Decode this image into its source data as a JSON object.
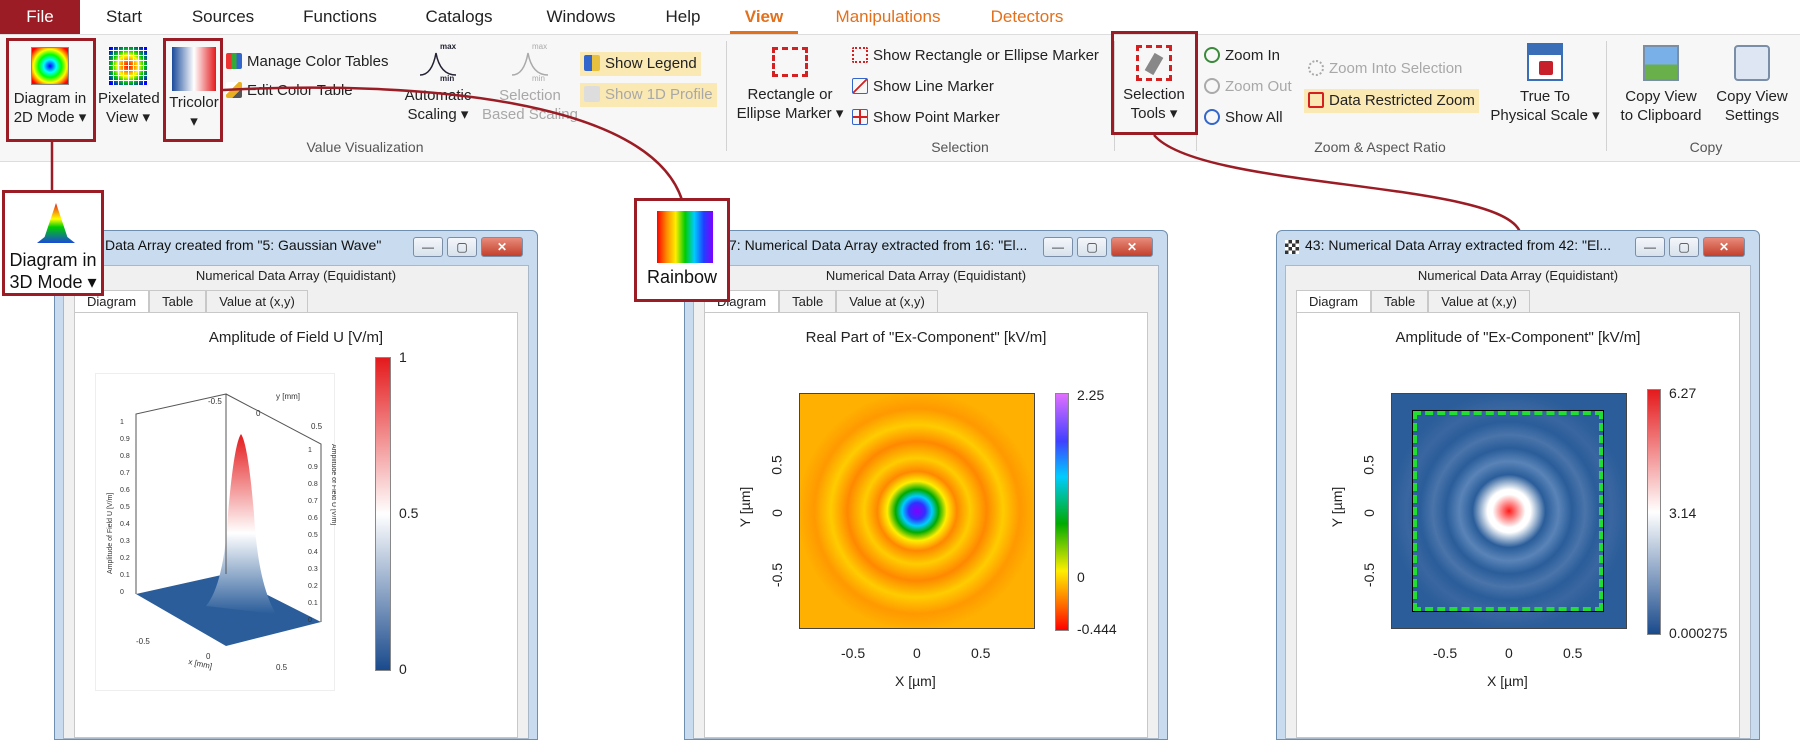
{
  "tabs": [
    "File",
    "Start",
    "Sources",
    "Functions",
    "Catalogs",
    "Windows",
    "Help",
    "View",
    "Manipulations",
    "Detectors"
  ],
  "ribbon": {
    "diagram2d": [
      "Diagram in",
      "2D Mode"
    ],
    "pixelated": [
      "Pixelated",
      "View"
    ],
    "tricolor": [
      "Tricolor"
    ],
    "manage_color_tables": "Manage Color Tables",
    "edit_color_table": "Edit Color Table",
    "auto_scaling": [
      "Automatic",
      "Scaling"
    ],
    "auto_scaling_icon": {
      "max": "max",
      "min": "min"
    },
    "selection_based": [
      "Selection",
      "Based Scaling"
    ],
    "show_legend": "Show Legend",
    "show_1d_profile": "Show 1D Profile",
    "rect_ellipse_marker": [
      "Rectangle or",
      "Ellipse Marker"
    ],
    "show_rect_marker": "Show Rectangle or Ellipse Marker",
    "show_line_marker": "Show Line Marker",
    "show_point_marker": "Show Point Marker",
    "selection_tools": [
      "Selection",
      "Tools"
    ],
    "zoom_in": "Zoom In",
    "zoom_out": "Zoom Out",
    "show_all": "Show All",
    "zoom_into_selection": "Zoom Into Selection",
    "data_restricted_zoom": "Data Restricted Zoom",
    "true_to_physical": [
      "True To",
      "Physical Scale"
    ],
    "copy_view_clipboard": [
      "Copy View",
      "to Clipboard"
    ],
    "copy_view_settings": [
      "Copy View",
      "Settings"
    ],
    "groups": [
      "Value Visualization",
      "Selection",
      "Zoom & Aspect Ratio",
      "Copy"
    ]
  },
  "callouts": {
    "diagram3d": [
      "Diagram in",
      "3D Mode"
    ],
    "rainbow": "Rainbow"
  },
  "windows": [
    {
      "title": "Data Array created from \"5: Gaussian Wave\"",
      "subtitle": "Numerical Data Array (Equidistant)",
      "tabs": [
        "Diagram",
        "Table",
        "Value at (x,y)"
      ],
      "plot_title": "Amplitude of Field U   [V/m]",
      "colorbar": [
        "1",
        "0.5",
        "0"
      ],
      "plot3d": {
        "axis_x": "x [mm]",
        "axis_y": "y [mm]",
        "axis_z": "Amplitude of Field U  [V/m]",
        "x_ticks": [
          "-0.5",
          "0",
          "0.5"
        ],
        "y_ticks": [
          "-0.5",
          "0",
          "0.5"
        ],
        "z_ticks": [
          "0",
          "0.1",
          "0.2",
          "0.3",
          "0.4",
          "0.5",
          "0.6",
          "0.7",
          "0.8",
          "0.9",
          "1"
        ]
      }
    },
    {
      "title": "7: Numerical Data Array extracted from 16: \"El...",
      "subtitle": "Numerical Data Array (Equidistant)",
      "tabs": [
        "Diagram",
        "Table",
        "Value at (x,y)"
      ],
      "plot_title": "Real Part of \"Ex-Component\"   [kV/m]",
      "colorbar": [
        "2.25",
        "0",
        "-0.444"
      ],
      "xlabel": "X [µm]",
      "ylabel": "Y [µm]",
      "xticks": [
        "-0.5",
        "0",
        "0.5"
      ],
      "yticks": [
        "0.5",
        "0",
        "-0.5"
      ]
    },
    {
      "title": "43: Numerical Data Array extracted from 42: \"El...",
      "subtitle": "Numerical Data Array (Equidistant)",
      "tabs": [
        "Diagram",
        "Table",
        "Value at (x,y)"
      ],
      "plot_title": "Amplitude of \"Ex-Component\"   [kV/m]",
      "colorbar": [
        "6.27",
        "3.14",
        "0.000275"
      ],
      "xlabel": "X [µm]",
      "ylabel": "Y [µm]",
      "xticks": [
        "-0.5",
        "0",
        "0.5"
      ],
      "yticks": [
        "0.5",
        "0",
        "-0.5"
      ]
    }
  ],
  "window_buttons": {
    "minimize": "—",
    "maximize": "▢",
    "close": "✕"
  },
  "colors": {
    "file_tab": "#9b1c24",
    "active_tab": "#e2701c",
    "callout_border": "#9b1c24",
    "marker": "#22dd33"
  }
}
